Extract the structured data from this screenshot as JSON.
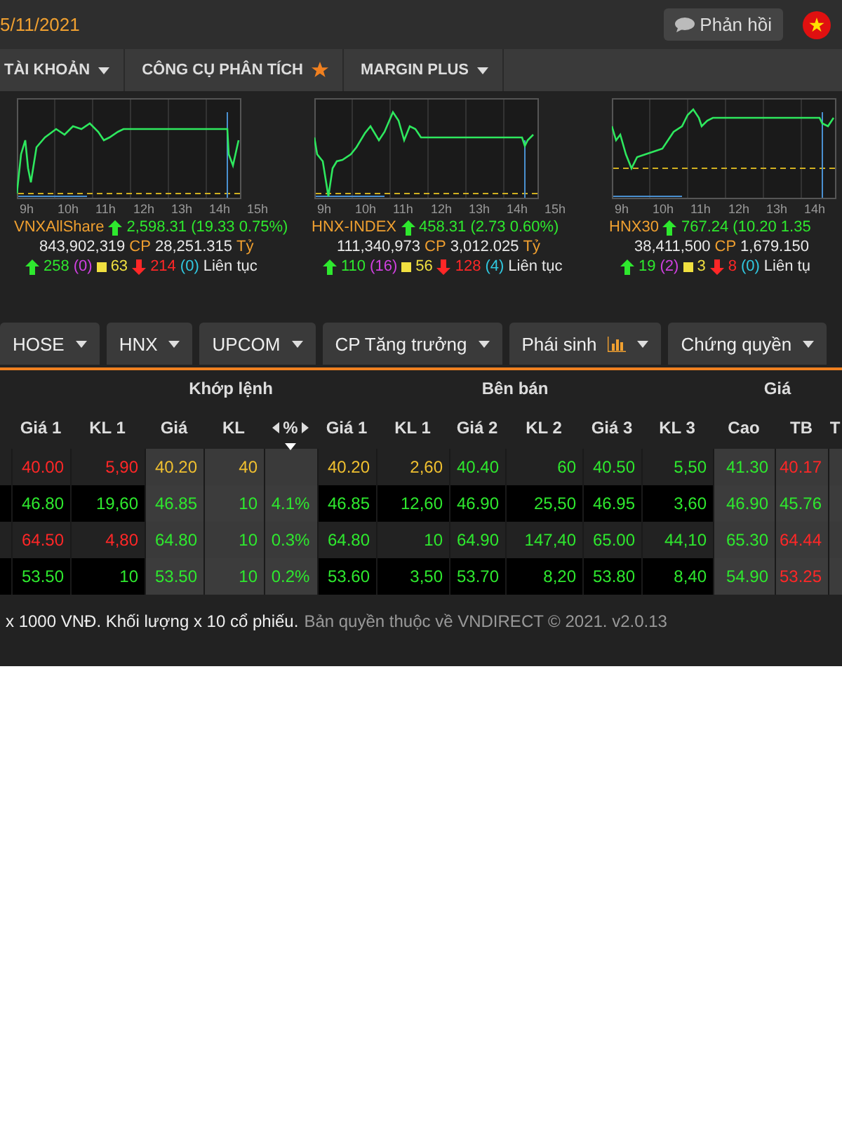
{
  "header": {
    "date": "5/11/2021",
    "feedback_button": "Phản hồi"
  },
  "nav": [
    {
      "label": "TÀI KHOẢN",
      "kind": "dropdown"
    },
    {
      "label": "CÔNG CỤ PHÂN TÍCH",
      "kind": "starred"
    },
    {
      "label": "MARGIN PLUS",
      "kind": "dropdown"
    }
  ],
  "indices": [
    {
      "name": "VNXAllShare",
      "change": "2,598.31 (19.33 0.75%)",
      "volume": "843,902,319",
      "volume_unit": "CP",
      "value": "28,251.315",
      "value_unit": "Tỷ",
      "up": "258",
      "ceiling": "(0)",
      "unchanged": "63",
      "down": "214",
      "floor": "(0)",
      "session": "Liên tục",
      "hours": [
        "9h",
        "10h",
        "11h",
        "12h",
        "13h",
        "14h",
        "15h"
      ]
    },
    {
      "name": "HNX-INDEX",
      "change": "458.31 (2.73 0.60%)",
      "volume": "111,340,973",
      "volume_unit": "CP",
      "value": "3,012.025",
      "value_unit": "Tỷ",
      "up": "110",
      "ceiling": "(16)",
      "unchanged": "56",
      "down": "128",
      "floor": "(4)",
      "session": "Liên tục",
      "hours": [
        "9h",
        "10h",
        "11h",
        "12h",
        "13h",
        "14h",
        "15h"
      ]
    },
    {
      "name": "HNX30",
      "change": "767.24 (10.20 1.35",
      "volume": "38,411,500",
      "volume_unit": "CP",
      "value": "1,679.150",
      "up": "19",
      "ceiling": "(2)",
      "unchanged": "3",
      "down": "8",
      "floor": "(0)",
      "session": "Liên tụ",
      "hours": [
        "9h",
        "10h",
        "11h",
        "12h",
        "13h",
        "14h"
      ]
    }
  ],
  "market_tabs": [
    {
      "label": "HOSE",
      "kind": "plain"
    },
    {
      "label": "HNX",
      "kind": "plain"
    },
    {
      "label": "UPCOM",
      "kind": "plain"
    },
    {
      "label": "CP Tăng trưởng",
      "kind": "plain"
    },
    {
      "label": "Phái sinh",
      "kind": "chart"
    },
    {
      "label": "Chứng quyền",
      "kind": "plain"
    }
  ],
  "table": {
    "groups": [
      "Khớp lệnh",
      "Bên bán",
      "Giá"
    ],
    "columns": [
      {
        "label": "Giá 1"
      },
      {
        "label": "KL 1"
      },
      {
        "label": "Giá"
      },
      {
        "label": "KL"
      },
      {
        "label": "%",
        "kind": "toggle"
      },
      {
        "label": "Giá 1"
      },
      {
        "label": "KL 1"
      },
      {
        "label": "Giá 2"
      },
      {
        "label": "KL 2"
      },
      {
        "label": "Giá 3"
      },
      {
        "label": "KL 3"
      },
      {
        "label": "Cao"
      },
      {
        "label": "TB"
      },
      {
        "label": "T"
      }
    ],
    "rows": [
      {
        "cells": [
          {
            "text": "40.00",
            "color": "#ff2727"
          },
          {
            "text": "5,90",
            "color": "#ff2727"
          },
          {
            "text": "40.20",
            "color": "#f0c030"
          },
          {
            "text": "40",
            "color": "#f0c030"
          },
          {},
          {
            "text": "40.20",
            "color": "#f0c030"
          },
          {
            "text": "2,60",
            "color": "#f0c030"
          },
          {
            "text": "40.40",
            "color": "#2ee82e"
          },
          {
            "text": "60",
            "color": "#2ee82e"
          },
          {
            "text": "40.50",
            "color": "#2ee82e"
          },
          {
            "text": "5,50",
            "color": "#2ee82e"
          },
          {
            "text": "41.30",
            "color": "#2ee82e"
          },
          {
            "text": "40.17",
            "color": "#ff2727"
          }
        ]
      },
      {
        "cells": [
          {
            "text": "46.80",
            "color": "#2ee82e"
          },
          {
            "text": "19,60",
            "color": "#2ee82e"
          },
          {
            "text": "46.85",
            "color": "#2ee82e"
          },
          {
            "text": "10",
            "color": "#2ee82e"
          },
          {
            "text": "4.1%",
            "color": "#2ee82e"
          },
          {
            "text": "46.85",
            "color": "#2ee82e"
          },
          {
            "text": "12,60",
            "color": "#2ee82e"
          },
          {
            "text": "46.90",
            "color": "#2ee82e"
          },
          {
            "text": "25,50",
            "color": "#2ee82e"
          },
          {
            "text": "46.95",
            "color": "#2ee82e"
          },
          {
            "text": "3,60",
            "color": "#2ee82e"
          },
          {
            "text": "46.90",
            "color": "#2ee82e"
          },
          {
            "text": "45.76",
            "color": "#2ee82e"
          }
        ]
      },
      {
        "cells": [
          {
            "text": "64.50",
            "color": "#ff2727"
          },
          {
            "text": "4,80",
            "color": "#ff2727"
          },
          {
            "text": "64.80",
            "color": "#2ee82e"
          },
          {
            "text": "10",
            "color": "#2ee82e"
          },
          {
            "text": "0.3%",
            "color": "#2ee82e"
          },
          {
            "text": "64.80",
            "color": "#2ee82e"
          },
          {
            "text": "10",
            "color": "#2ee82e"
          },
          {
            "text": "64.90",
            "color": "#2ee82e"
          },
          {
            "text": "147,40",
            "color": "#2ee82e"
          },
          {
            "text": "65.00",
            "color": "#2ee82e"
          },
          {
            "text": "44,10",
            "color": "#2ee82e"
          },
          {
            "text": "65.30",
            "color": "#2ee82e"
          },
          {
            "text": "64.44",
            "color": "#ff2727"
          }
        ]
      },
      {
        "cells": [
          {
            "text": "53.50",
            "color": "#2ee82e"
          },
          {
            "text": "10",
            "color": "#2ee82e"
          },
          {
            "text": "53.50",
            "color": "#2ee82e"
          },
          {
            "text": "10",
            "color": "#2ee82e"
          },
          {
            "text": "0.2%",
            "color": "#2ee82e"
          },
          {
            "text": "53.60",
            "color": "#2ee82e"
          },
          {
            "text": "3,50",
            "color": "#2ee82e"
          },
          {
            "text": "53.70",
            "color": "#2ee82e"
          },
          {
            "text": "8,20",
            "color": "#2ee82e"
          },
          {
            "text": "53.80",
            "color": "#2ee82e"
          },
          {
            "text": "8,40",
            "color": "#2ee82e"
          },
          {
            "text": "54.90",
            "color": "#2ee82e"
          },
          {
            "text": "53.25",
            "color": "#ff2727"
          }
        ]
      }
    ]
  },
  "footer": {
    "note": "x 1000 VNĐ. Khối lượng x 10 cổ phiếu.",
    "copyright": "Bản quyền thuộc về VNDIRECT © 2021. v2.0.13"
  }
}
